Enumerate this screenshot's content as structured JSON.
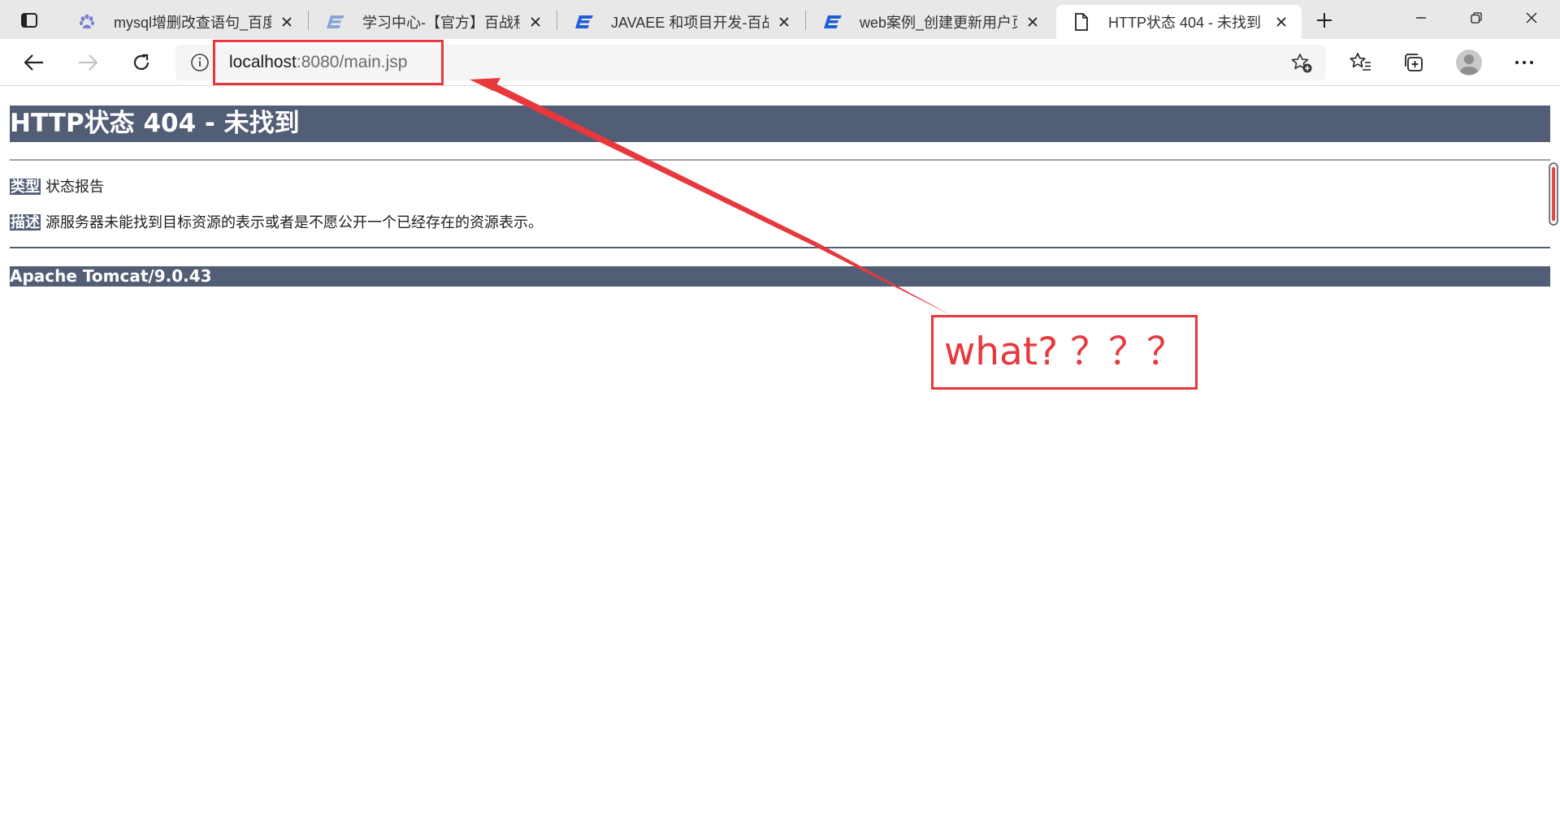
{
  "browser": {
    "tabs": [
      {
        "title": "mysql增删改查语句_百度搜索",
        "favicon": "baidu-paw-icon",
        "active": false
      },
      {
        "title": "学习中心-【官方】百战程序员",
        "favicon": "bz-logo-icon",
        "active": false
      },
      {
        "title": "JAVAEE 和项目开发-百战程序员",
        "favicon": "bz-logo-icon",
        "active": false
      },
      {
        "title": "web案例_创建更新用户页面",
        "favicon": "bz-logo-icon",
        "active": false
      },
      {
        "title": "HTTP状态 404 - 未找到",
        "favicon": "page-icon",
        "active": true
      }
    ],
    "address": {
      "host": "localhost",
      "rest": ":8080/main.jsp"
    }
  },
  "page": {
    "heading": "HTTP状态 404 - 未找到",
    "type_label": "类型",
    "type_value": "状态报告",
    "desc_label": "描述",
    "desc_value": "源服务器未能找到目标资源的表示或者是不愿公开一个已经存在的资源表示。",
    "footer": "Apache Tomcat/9.0.43"
  },
  "annotation": {
    "callout_text": "what? ？？？",
    "color": "#e8383d"
  },
  "colors": {
    "tomcat_bar": "#525d76",
    "tabstrip": "#e8e8e8"
  }
}
